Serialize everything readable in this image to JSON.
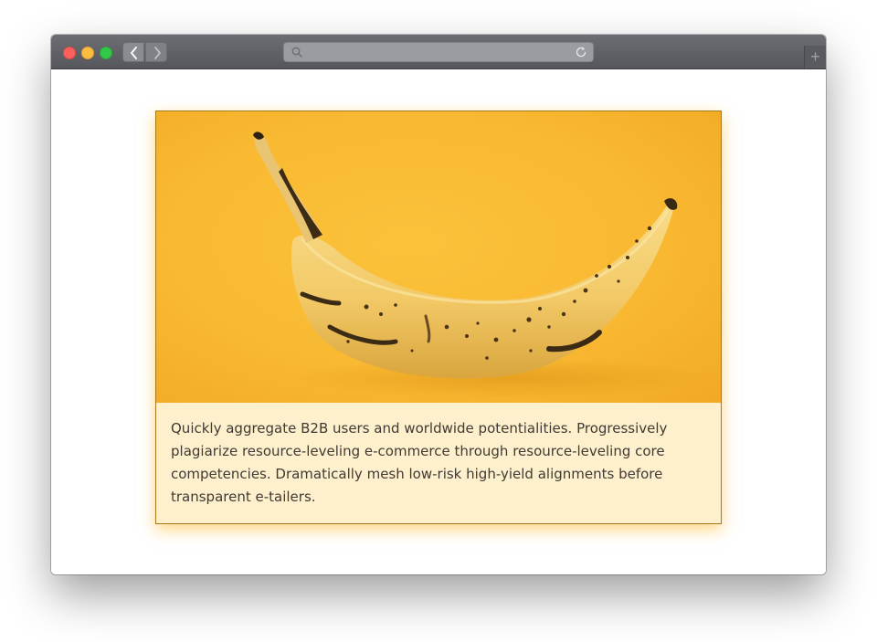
{
  "window": {
    "controls": [
      "close",
      "minimize",
      "maximize"
    ],
    "nav": {
      "back_icon": "chevron-left-icon",
      "forward_icon": "chevron-right-icon"
    },
    "address_bar": {
      "value": "",
      "search_icon": "search-icon",
      "reload_icon": "reload-icon"
    },
    "new_tab_label": "+"
  },
  "card": {
    "image_subject": "banana-image",
    "text": "Quickly aggregate B2B users and worldwide potentialities. Progressively plagiarize resource-leveling e-commerce through resource-leveling core competencies. Dramatically mesh low-risk high-yield alignments before transparent e-tailers."
  },
  "colors": {
    "card_background": "#fff0cd",
    "card_border": "#a8781c",
    "image_background": "#f9b932",
    "close": "#fc605c",
    "minimize": "#fdbc40",
    "maximize": "#34c84a"
  }
}
